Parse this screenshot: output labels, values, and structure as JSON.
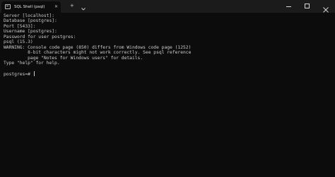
{
  "window": {
    "tab_title": "SQL Shell (psql)",
    "tab_icon": "terminal-icon",
    "new_tab_label": "+",
    "tab_menu_icon": "chevron-down-icon",
    "close_tab_label": "✕",
    "controls": [
      "minimize-icon",
      "maximize-icon",
      "close-icon"
    ]
  },
  "console": {
    "lines": [
      "Server [localhost]:",
      "Database [postgres]:",
      "Port [5433]:",
      "Username [postgres]:",
      "Password for user postgres:",
      "psql (15.3)",
      "WARNING: Console code page (850) differs from Windows code page (1252)",
      "         8-bit characters might not work correctly. See psql reference",
      "         page \"Notes for Windows users\" for details.",
      "Type \"help\" for help.",
      "",
      "postgres=# "
    ]
  },
  "colors": {
    "background": "#0c0c0c",
    "titlebar": "#1b1b1b",
    "text": "#cccccc"
  }
}
